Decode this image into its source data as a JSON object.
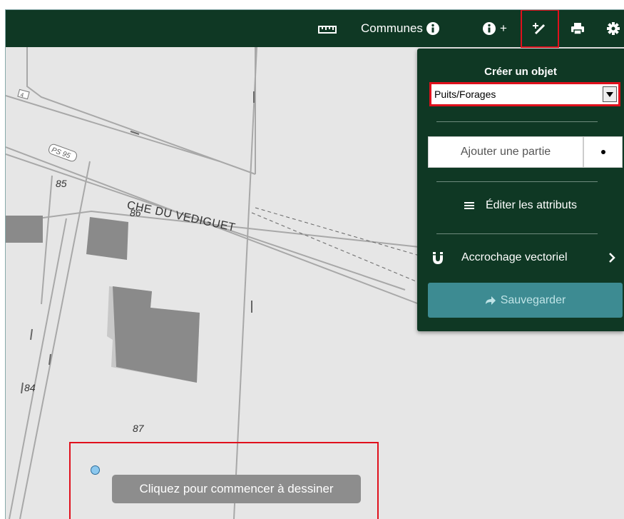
{
  "toolbar": {
    "communes_label": "Communes",
    "info_plus_label": "+"
  },
  "map": {
    "street_name": "CHE DU VEDIGUET",
    "road_badges": [
      "4",
      "PS 95"
    ],
    "parcel_numbers": {
      "p85": "85",
      "p86": "86",
      "p84": "84",
      "p87": "87"
    }
  },
  "panel": {
    "title": "Créer un objet",
    "layer_value": "Puits/Forages",
    "add_part_label": "Ajouter une partie",
    "edit_attributes_label": "Éditer les attributs",
    "snapping_label": "Accrochage vectoriel",
    "save_label": "Sauvegarder"
  },
  "drawing": {
    "tooltip": "Cliquez pour commencer à dessiner"
  },
  "colors": {
    "toolbar_bg": "#0f3824",
    "highlight": "#e0101c",
    "save_button": "#3d8b92",
    "map_bg": "#e6e6e6"
  },
  "icons": [
    "ruler-icon",
    "info-icon",
    "info-plus-icon",
    "edit-draw-icon",
    "print-icon",
    "gear-icon",
    "list-icon",
    "magnet-icon",
    "chevron-right-icon",
    "arrow-right-icon",
    "point-icon"
  ]
}
